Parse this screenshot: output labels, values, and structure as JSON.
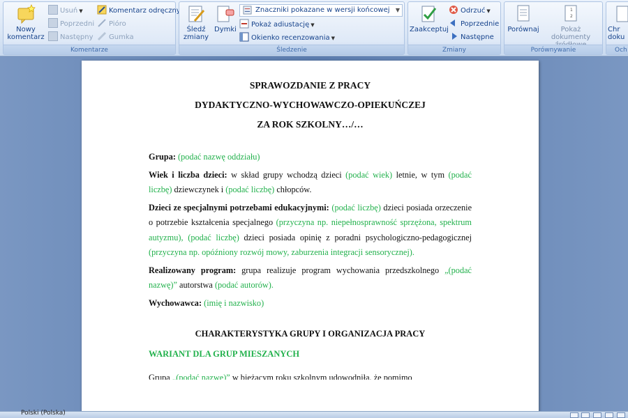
{
  "ribbon": {
    "komentarze": {
      "label": "Komentarze",
      "new_comment": "Nowy komentarz",
      "delete": "Usuń",
      "previous": "Poprzedni",
      "next": "Następny",
      "handwritten": "Komentarz odręczny",
      "pen": "Pióro",
      "eraser": "Gumka"
    },
    "sledzenie": {
      "label": "Śledzenie",
      "track_changes": "Śledź zmiany",
      "balloons": "Dymki",
      "display_mode": "Znaczniki pokazane w wersji końcowej",
      "show_markup": "Pokaż adiustację",
      "review_pane": "Okienko recenzowania"
    },
    "zmiany": {
      "label": "Zmiany",
      "accept": "Zaakceptuj",
      "reject": "Odrzuć",
      "previous": "Poprzednie",
      "next": "Następne"
    },
    "porownywanie": {
      "label": "Porównywanie",
      "compare": "Porównaj",
      "show_source": "Pokaż dokumenty źródłowe"
    },
    "ochrona": {
      "label": "Och",
      "protect": "Chr doku"
    }
  },
  "document": {
    "title1": "SPRAWOZDANIE Z PRACY",
    "title2": "DYDAKTYCZNO-WYCHOWAWCZO-OPIEKUŃCZEJ",
    "title3": "ZA ROK SZKOLNY…/…",
    "grupa_label": "Grupa:",
    "grupa_value": "(podać nazwę oddziału)",
    "wiek_label": "Wiek i liczba dzieci:",
    "wiek_t1": "w skład grupy wchodzą dzieci",
    "wiek_g1": "(podać wiek)",
    "wiek_t2": "letnie, w tym",
    "wiek_g2": "(podać liczbę)",
    "wiek_t3": "dziewczynek i",
    "wiek_g3": "(podać liczbę)",
    "wiek_t4": "chłopców.",
    "spec_label": "Dzieci ze specjalnymi potrzebami edukacyjnymi:",
    "spec_g1": "(podać liczbę)",
    "spec_t1": "dzieci posiada orzeczenie o potrzebie kształcenia specjalnego",
    "spec_g2": "(przyczyna np. niepełnosprawność sprzężona, spektrum autyzmu),",
    "spec_g3": "(podać liczbę)",
    "spec_t2": "dzieci posiada opinię z poradni psychologiczno-pedagogicznej",
    "spec_g4": "(przyczyna np. opóźniony rozwój mowy, zaburzenia integracji sensorycznej).",
    "prog_label": "Realizowany program:",
    "prog_t1": "grupa realizuje program wychowania przedszkolnego",
    "prog_g1": "„(podać nazwę)”",
    "prog_t2": "autorstwa",
    "prog_g2": "(podać autorów).",
    "wych_label": "Wychowawca:",
    "wych_value": "(imię i nazwisko)",
    "section_title": "CHARAKTERYSTYKA  GRUPY I ORGANIZACJA  PRACY",
    "variant_title": "WARIANT  DLA GRUP  MIESZANYCH",
    "cut_t1": "Grupa",
    "cut_g1": "„(podać nazwę)”",
    "cut_t2": "w bieżącym roku szkolnym udowodniła, że pomimo"
  },
  "status": {
    "language": "Polski (Polska)"
  },
  "colors": {
    "placeholder_green": "#22b14c",
    "ribbon_text": "#15428b"
  }
}
